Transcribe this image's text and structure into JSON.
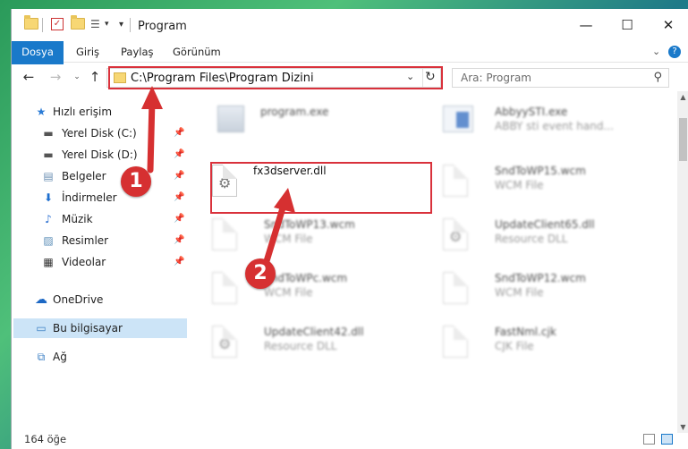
{
  "window": {
    "title": "Program",
    "minimize": "—",
    "maximize": "☐",
    "close": "✕"
  },
  "ribbon": {
    "tabs": [
      "Dosya",
      "Giriş",
      "Paylaş",
      "Görünüm"
    ]
  },
  "address": {
    "path": "C:\\Program Files\\Program Dizini"
  },
  "search": {
    "placeholder": "Ara: Program"
  },
  "nav": {
    "items": [
      {
        "label": "Hızlı erişim",
        "icon": "star-icon"
      },
      {
        "label": "Yerel Disk (C:)",
        "icon": "drive-icon"
      },
      {
        "label": "Yerel Disk (D:)",
        "icon": "drive-icon"
      },
      {
        "label": "Belgeler",
        "icon": "documents-icon"
      },
      {
        "label": "İndirmeler",
        "icon": "download-icon"
      },
      {
        "label": "Müzik",
        "icon": "music-icon"
      },
      {
        "label": "Resimler",
        "icon": "pictures-icon"
      },
      {
        "label": "Videolar",
        "icon": "video-icon"
      },
      {
        "label": "OneDrive",
        "icon": "cloud-icon"
      },
      {
        "label": "Bu bilgisayar",
        "icon": "computer-icon"
      },
      {
        "label": "Ağ",
        "icon": "network-icon"
      }
    ]
  },
  "files": [
    {
      "name": "program.exe",
      "type": ""
    },
    {
      "name": "AbbyySTI.exe",
      "type": "ABBY sti event hand..."
    },
    {
      "name": "fx3dserver.dll",
      "type": ""
    },
    {
      "name": "SndToWP15.wcm",
      "type": "WCM File"
    },
    {
      "name": "SndToWP13.wcm",
      "type": "WCM File"
    },
    {
      "name": "UpdateClient65.dll",
      "type": "Resource DLL"
    },
    {
      "name": "SndToWPc.wcm",
      "type": "WCM File"
    },
    {
      "name": "SndToWP12.wcm",
      "type": "WCM File"
    },
    {
      "name": "UpdateClient42.dll",
      "type": "Resource DLL"
    },
    {
      "name": "FastNml.cjk",
      "type": "CJK File"
    }
  ],
  "status": {
    "count": "164 öğe"
  },
  "annotations": {
    "step1": "1",
    "step2": "2",
    "color": "#d63031"
  }
}
